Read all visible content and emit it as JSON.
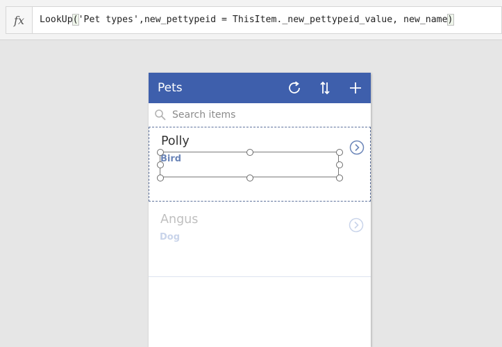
{
  "formula_bar": {
    "fx_label": "fx",
    "formula_start": "LookUp",
    "open_paren": "(",
    "formula_args": "'Pet types',new_pettypeid = ThisItem._new_pettypeid_value, new_name",
    "close_paren": ")"
  },
  "app": {
    "title": "Pets",
    "header_color": "#3e5fac",
    "icons": [
      "refresh-icon",
      "sort-icon",
      "add-icon"
    ],
    "search": {
      "placeholder": "Search items"
    },
    "items": [
      {
        "title": "Polly",
        "subtitle": "Bird",
        "selected": true
      },
      {
        "title": "Angus",
        "subtitle": "Dog",
        "selected": false
      }
    ]
  }
}
